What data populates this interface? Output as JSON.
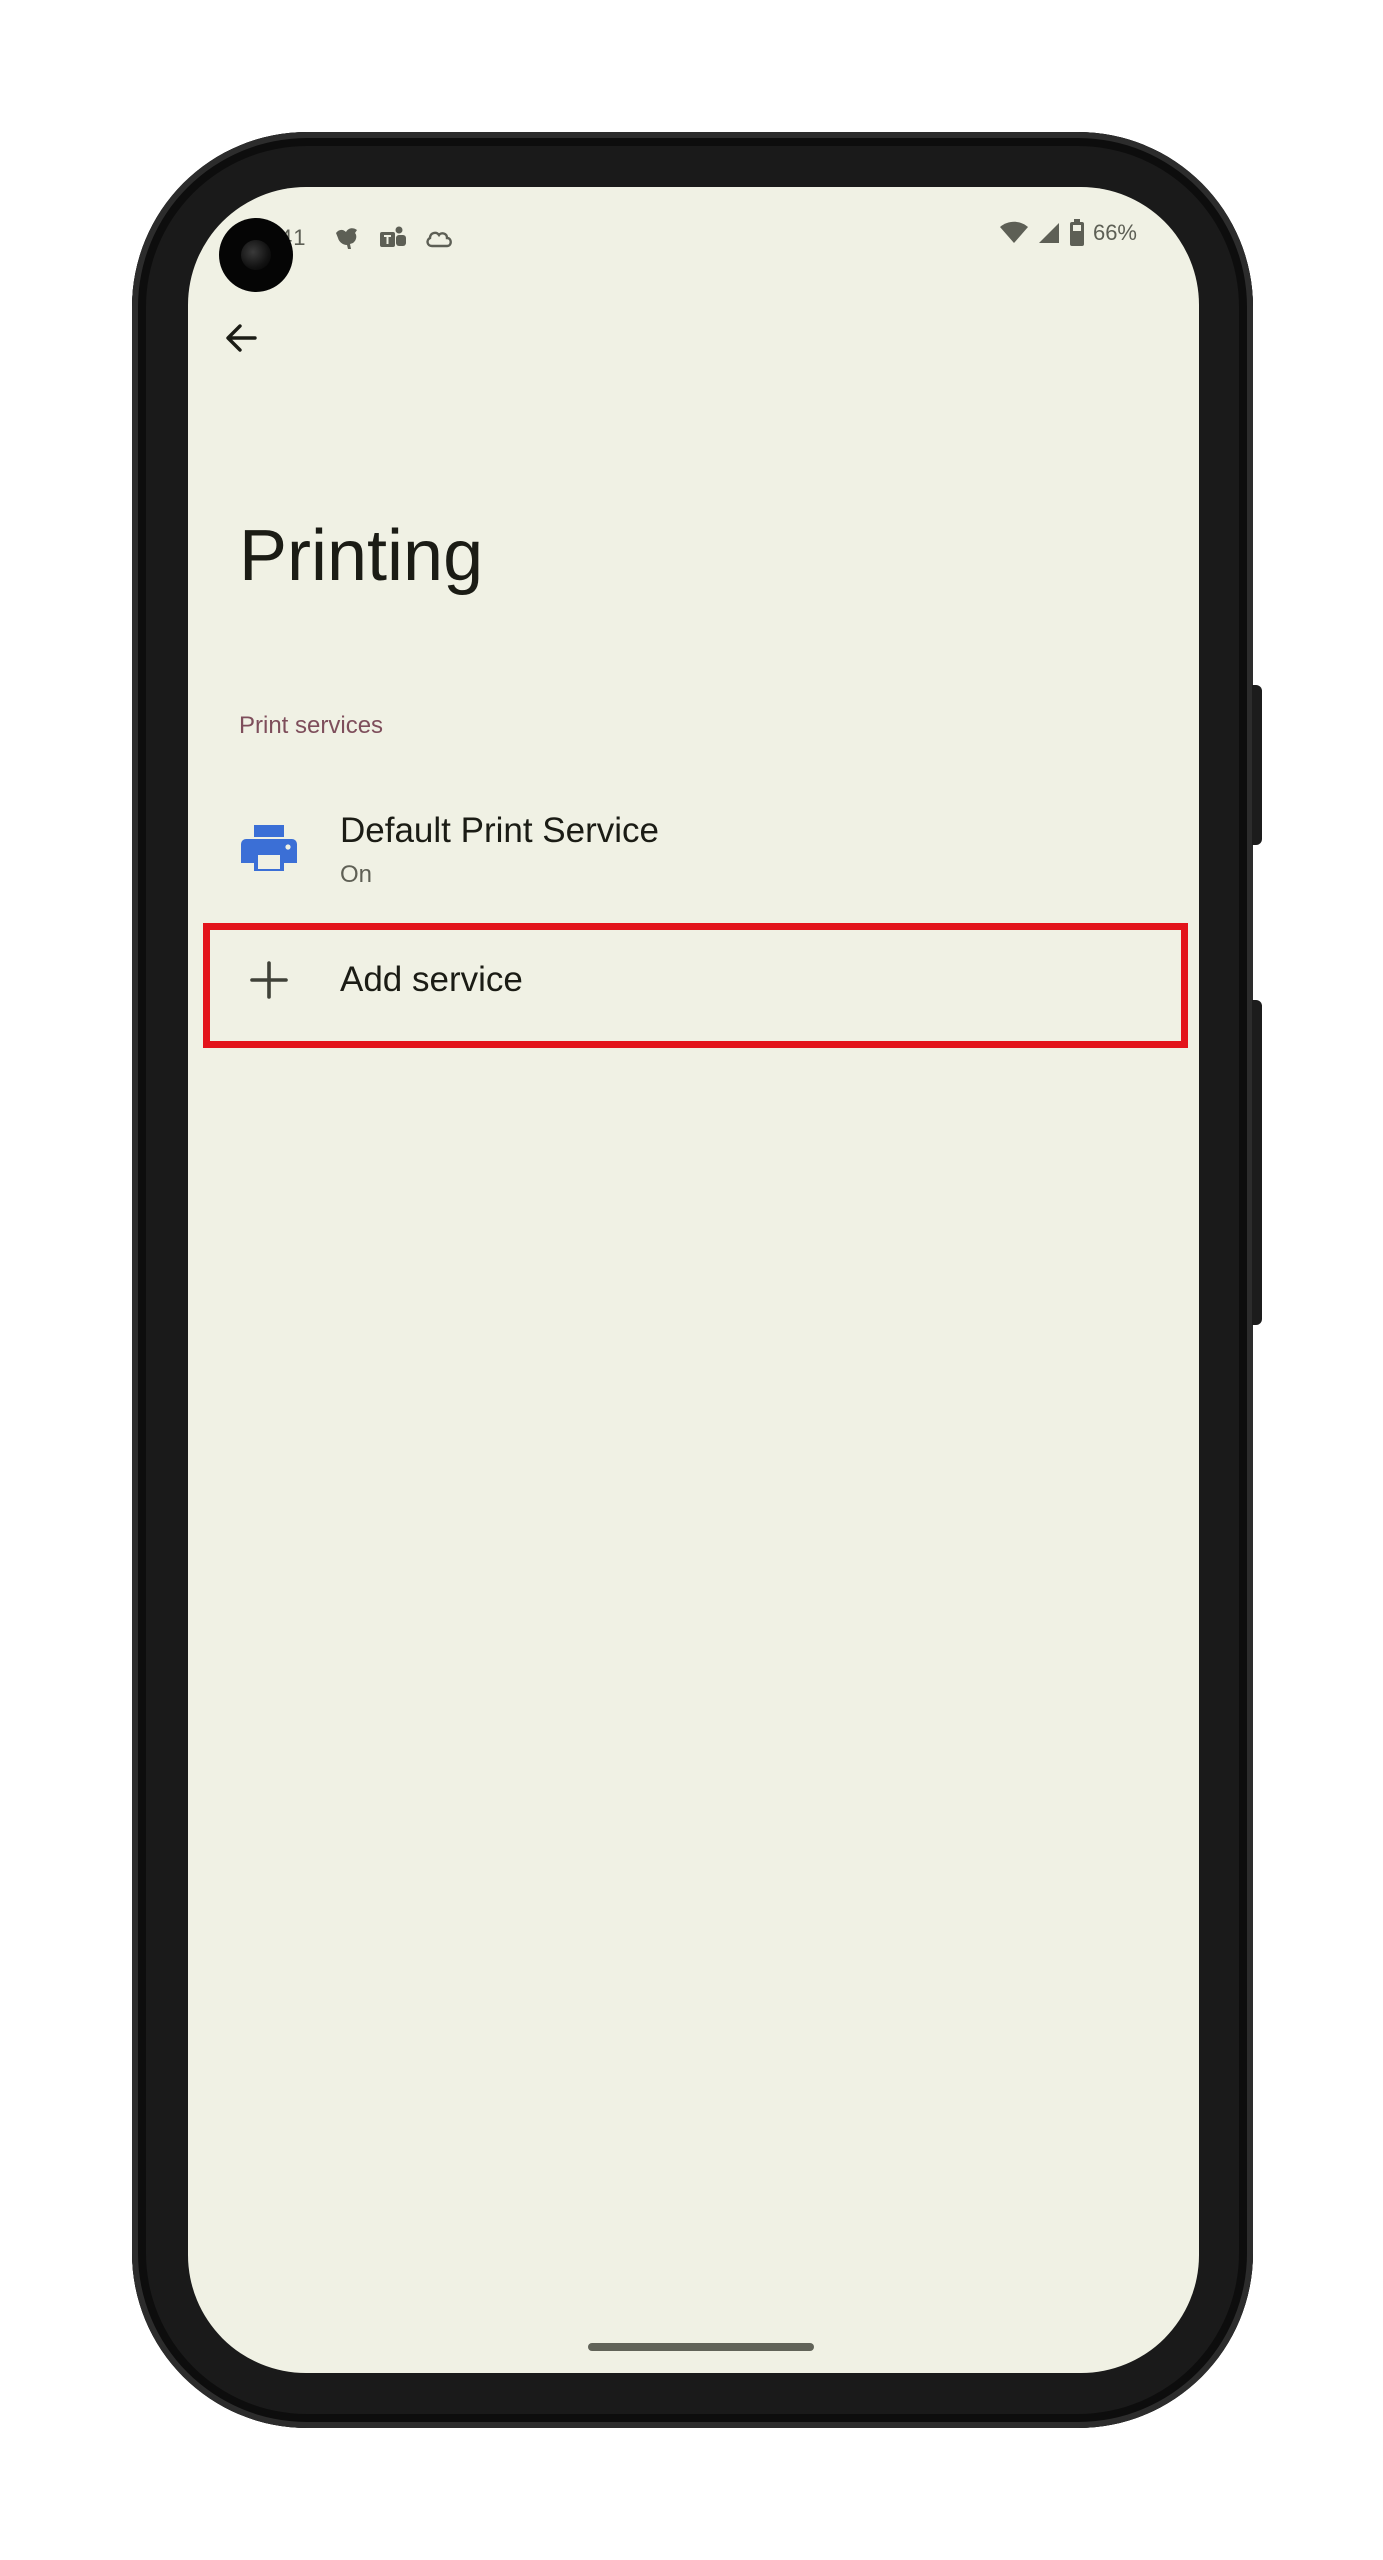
{
  "status_bar": {
    "time": "41",
    "battery": "66%",
    "left_icons": [
      "bird-icon",
      "teams-icon",
      "cloud-icon"
    ],
    "right_icons": [
      "wifi-icon",
      "cell-signal-icon",
      "battery-icon"
    ]
  },
  "app_bar": {
    "back_icon": "arrow-back-icon"
  },
  "page": {
    "title": "Printing",
    "section_header": "Print services"
  },
  "services": [
    {
      "title": "Default Print Service",
      "summary": "On",
      "icon": "printer-icon"
    }
  ],
  "add_service": {
    "label": "Add service",
    "icon": "plus-icon"
  },
  "colors": {
    "background": "#f0f1e4",
    "section_header": "#7e4e5b",
    "printer_icon": "#3b6fd6",
    "highlight": "#e3141b"
  }
}
